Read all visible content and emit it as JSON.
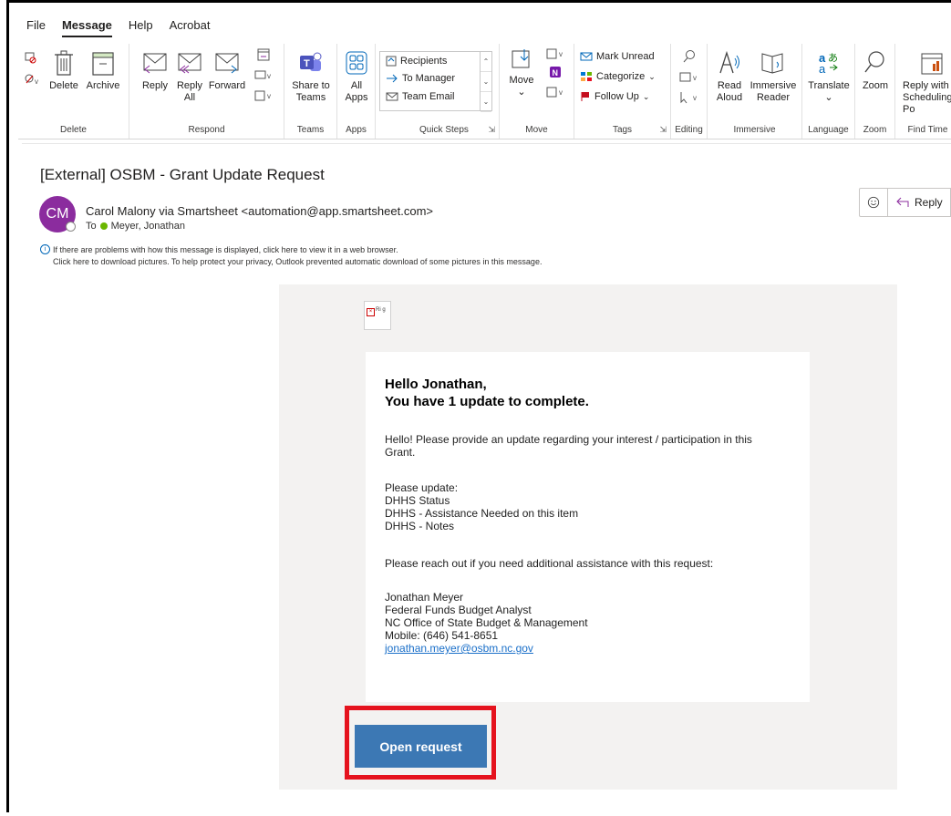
{
  "menu": [
    "File",
    "Message",
    "Help",
    "Acrobat"
  ],
  "ribbon": {
    "delete": {
      "delete_label": "Delete",
      "archive_label": "Archive",
      "group": "Delete"
    },
    "respond": {
      "reply": "Reply",
      "reply_all_1": "Reply",
      "reply_all_2": "All",
      "forward": "Forward",
      "group": "Respond"
    },
    "teams": {
      "share_1": "Share to",
      "share_2": "Teams",
      "group": "Teams"
    },
    "apps": {
      "all_1": "All",
      "all_2": "Apps",
      "group": "Apps"
    },
    "quick_steps": {
      "items": [
        "Recipients",
        "To Manager",
        "Team Email"
      ],
      "group": "Quick Steps"
    },
    "move": {
      "move_label": "Move",
      "group": "Move"
    },
    "tags": {
      "mark_unread": "Mark Unread",
      "categorize": "Categorize",
      "follow_up": "Follow Up",
      "group": "Tags"
    },
    "editing": {
      "group": "Editing"
    },
    "immersive": {
      "read_1": "Read",
      "read_2": "Aloud",
      "reader_1": "Immersive",
      "reader_2": "Reader",
      "group": "Immersive"
    },
    "language": {
      "translate": "Translate",
      "group": "Language"
    },
    "zoom": {
      "zoom": "Zoom",
      "group": "Zoom"
    },
    "find_time": {
      "reply_with_1": "Reply with",
      "reply_with_2": "Scheduling Po",
      "group": "Find Time"
    }
  },
  "message": {
    "subject": "[External] OSBM - Grant Update Request",
    "avatar_initials": "CM",
    "sender": "Carol Malony via Smartsheet <automation@app.smartsheet.com>",
    "to_label": "To",
    "to_name": "Meyer, Jonathan",
    "info_line1": "If there are problems with how this message is displayed, click here to view it in a web browser.",
    "info_line2": "Click here to download pictures. To help protect your privacy, Outlook prevented automatic download of some pictures in this message.",
    "reply_label": "Reply"
  },
  "email": {
    "broken_image_text": "Ri g",
    "greeting_1": "Hello Jonathan,",
    "greeting_2": "You have 1 update to complete.",
    "para1_1": "Hello! Please provide an update regarding your interest / participation in this",
    "para1_2": "Grant.",
    "update_heading": "Please update:",
    "update_items": [
      "DHHS Status",
      "DHHS - Assistance Needed on this item",
      "DHHS - Notes"
    ],
    "reach_out": "Please reach out if you need additional assistance with this request:",
    "sig_name": "Jonathan Meyer",
    "sig_title": "Federal Funds Budget Analyst",
    "sig_org": "NC Office of State Budget & Management",
    "sig_mobile": "Mobile: (646) 541-8651",
    "sig_email": "jonathan.meyer@osbm.nc.gov",
    "open_request": "Open request"
  },
  "colors": {
    "avatar": "#8b2c9e",
    "button": "#3c78b4",
    "highlight": "#e5131e",
    "link": "#1a6fc9"
  }
}
